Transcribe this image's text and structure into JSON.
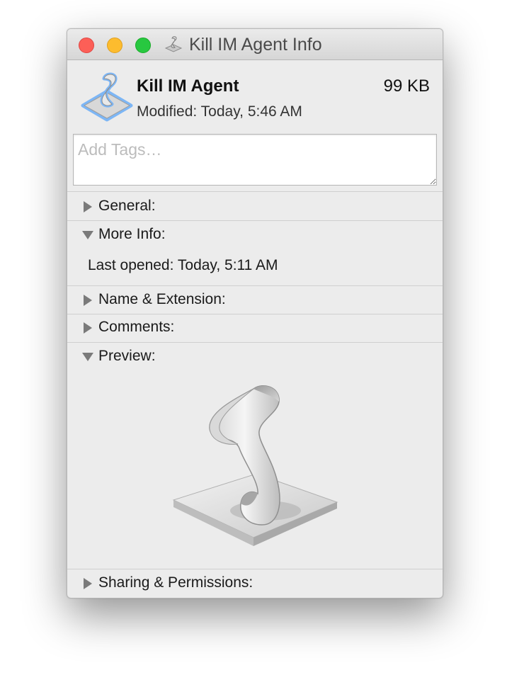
{
  "window": {
    "title": "Kill IM Agent Info"
  },
  "file": {
    "name": "Kill IM Agent",
    "size": "99 KB",
    "modified": "Modified: Today, 5:46 AM"
  },
  "tags": {
    "placeholder": "Add Tags…"
  },
  "sections": {
    "general": {
      "label": "General:",
      "expanded": false
    },
    "more_info": {
      "label": "More Info:",
      "expanded": true,
      "last_opened": "Last opened: Today, 5:11 AM"
    },
    "name_extension": {
      "label": "Name & Extension:",
      "expanded": false
    },
    "comments": {
      "label": "Comments:",
      "expanded": false
    },
    "preview": {
      "label": "Preview:",
      "expanded": true
    },
    "sharing_permissions": {
      "label": "Sharing & Permissions:",
      "expanded": false
    }
  },
  "icons": {
    "file_icon": "script-app-icon",
    "preview": "script-app-icon",
    "collapsed": "disclosure-triangle-right",
    "expanded": "disclosure-triangle-down"
  },
  "colors": {
    "close": "#fc5f57",
    "minimize": "#fdbc2e",
    "zoom": "#28c840",
    "selection_outline": "#7db6f5"
  }
}
